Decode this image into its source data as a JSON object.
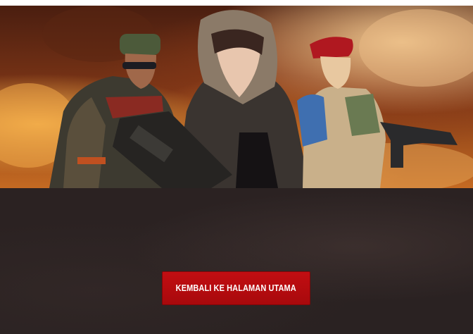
{
  "hero": {
    "characters": [
      "soldier-character",
      "hooded-woman-character",
      "red-beret-character"
    ]
  },
  "actions": {
    "home_button_label": "KEMBALI KE HALAMAN UTAMA"
  },
  "colors": {
    "button": "#b80c10",
    "background": "#2a2323",
    "banner_fire": "#c46a22"
  }
}
